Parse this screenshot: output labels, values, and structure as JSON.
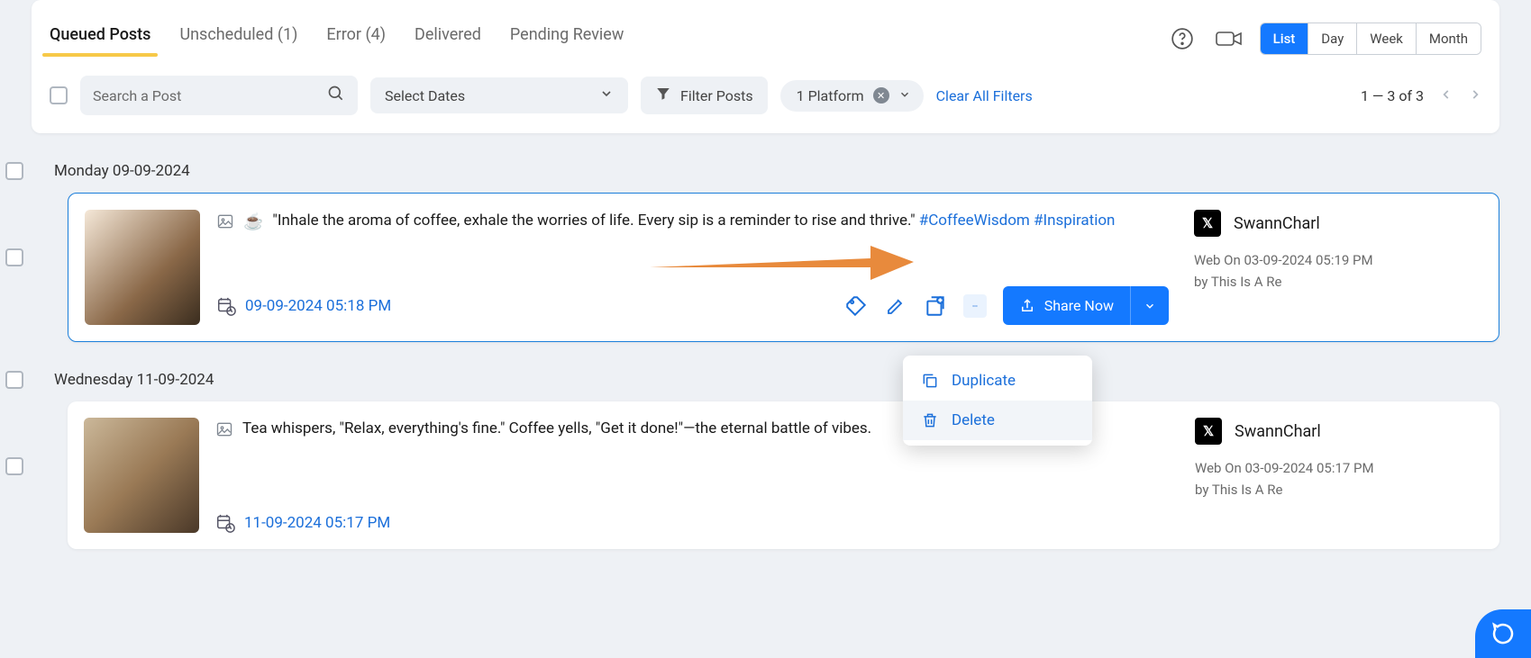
{
  "tabs": {
    "queued": "Queued Posts",
    "unscheduled": "Unscheduled  (1)",
    "error": "Error  (4)",
    "delivered": "Delivered",
    "pending": "Pending Review"
  },
  "viewSwitch": {
    "list": "List",
    "day": "Day",
    "week": "Week",
    "month": "Month"
  },
  "search": {
    "placeholder": "Search a Post"
  },
  "dateSelect": {
    "label": "Select Dates"
  },
  "filterPosts": {
    "label": "Filter Posts"
  },
  "platformChip": {
    "label": "1 Platform"
  },
  "clearFilters": "Clear All Filters",
  "pager": {
    "text": "1 — 3 of 3"
  },
  "group1": {
    "label": "Monday 09-09-2024"
  },
  "post1": {
    "text": "\"Inhale the aroma of coffee, exhale the worries of life. Every sip is a reminder to rise and thrive.\" ",
    "hashtags": "#CoffeeWisdom #Inspiration",
    "datetime": "09-09-2024 05:18 PM",
    "account": "SwannCharl",
    "meta1": "Web On 03-09-2024 05:19 PM",
    "meta2": "by This Is A Re"
  },
  "shareNow": "Share Now",
  "dropdown": {
    "duplicate": "Duplicate",
    "delete": "Delete"
  },
  "group2": {
    "label": "Wednesday 11-09-2024"
  },
  "post2": {
    "text": "Tea whispers, \"Relax, everything's fine.\" Coffee yells, \"Get it done!\"—the eternal battle of vibes.",
    "datetime": "11-09-2024 05:17 PM",
    "account": "SwannCharl",
    "meta1": "Web On 03-09-2024 05:17 PM",
    "meta2": "by This Is A Re"
  }
}
